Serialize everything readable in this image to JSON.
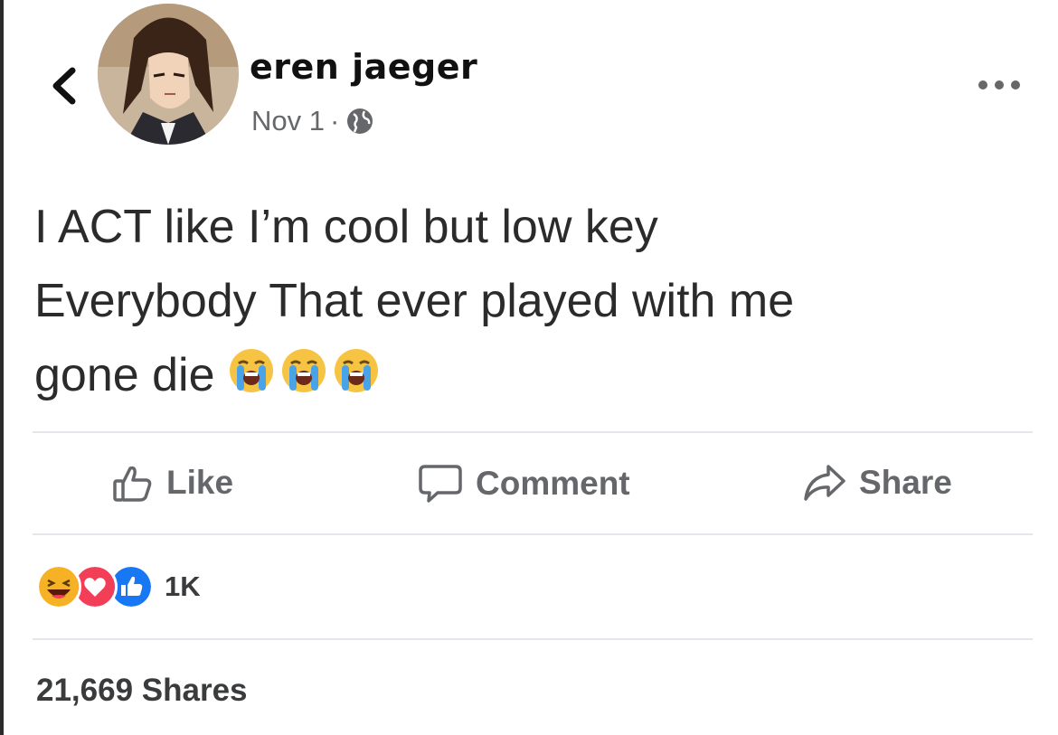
{
  "header": {
    "author_name": "eren jaeger",
    "date": "Nov 1",
    "separator": "·",
    "icons": [
      "chevron-left-icon",
      "globe-icon",
      "more-options-icon"
    ]
  },
  "post": {
    "lines": [
      "I ACT like I’m cool but low key",
      "Everybody That ever played with me",
      "gone die"
    ],
    "emojis": [
      "loudly-crying-face",
      "loudly-crying-face",
      "loudly-crying-face"
    ]
  },
  "actions": {
    "like_label": "Like",
    "comment_label": "Comment",
    "share_label": "Share"
  },
  "reactions": {
    "types": [
      "haha",
      "love",
      "like"
    ],
    "count": "1K"
  },
  "shares": {
    "text": "21,669 Shares"
  },
  "colors": {
    "secondary_text": "#65676b",
    "like_blue": "#1877f2",
    "love_red": "#f33e58",
    "haha_yellow": "#f7b125"
  }
}
